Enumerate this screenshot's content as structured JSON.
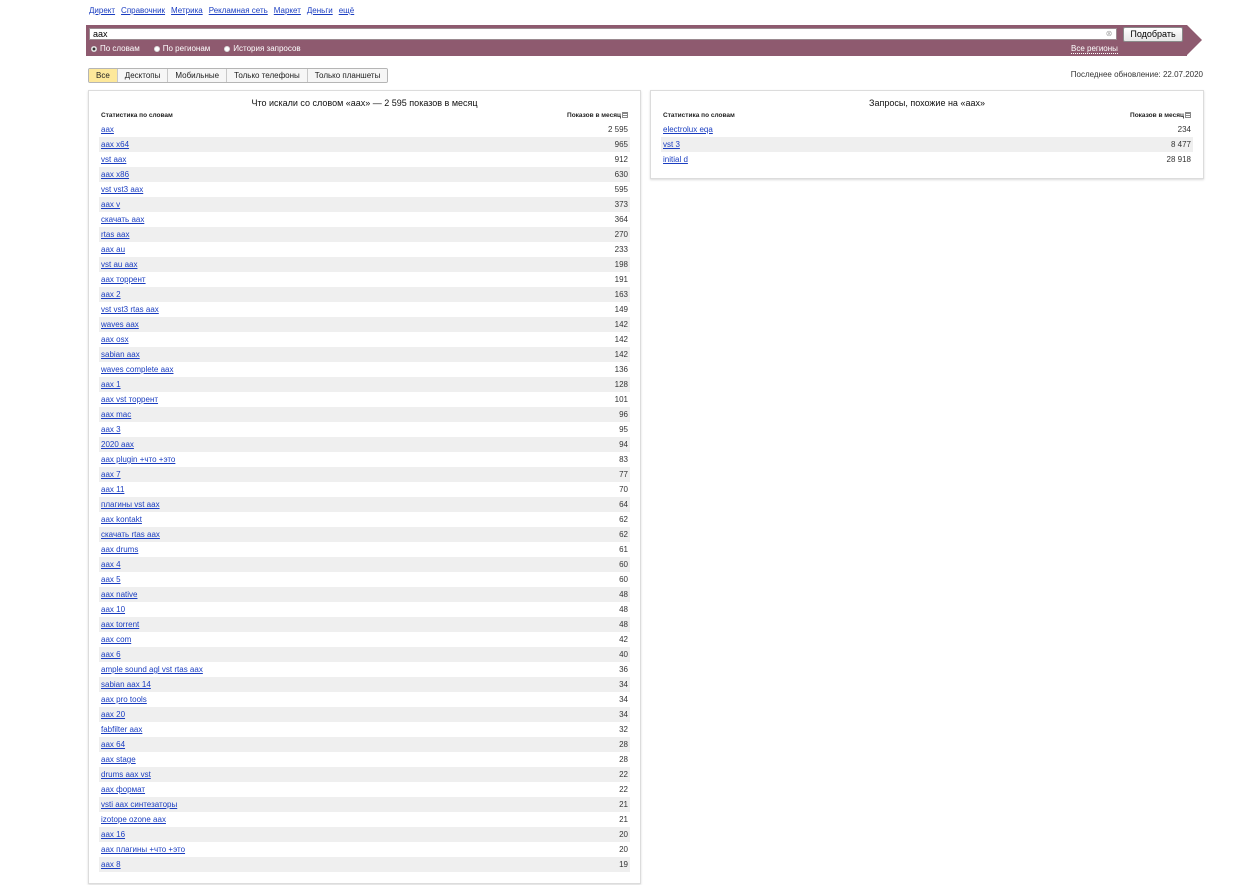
{
  "nav": [
    "Директ",
    "Справочник",
    "Метрика",
    "Рекламная сеть",
    "Маркет",
    "Деньги",
    "ещё"
  ],
  "search": {
    "value": "аах",
    "button_label": "Подобрать",
    "modes": [
      {
        "label": "По словам",
        "checked": true
      },
      {
        "label": "По регионам",
        "checked": false
      },
      {
        "label": "История запросов",
        "checked": false
      }
    ],
    "all_regions_label": "Все регионы"
  },
  "colors": {
    "band": "#8e5a6f",
    "active_tab": "#fde89a",
    "link": "#1a3dc1"
  },
  "tabs": [
    {
      "label": "Все",
      "active": true
    },
    {
      "label": "Десктопы",
      "active": false
    },
    {
      "label": "Мобильные",
      "active": false
    },
    {
      "label": "Только телефоны",
      "active": false
    },
    {
      "label": "Только планшеты",
      "active": false
    }
  ],
  "last_update": "Последнее обновление: 22.07.2020",
  "left_panel": {
    "title": "Что искали со словом «аах» — 2 595 показов в месяц",
    "col_phrase": "Статистика по словам",
    "col_shows": "Показов в месяц",
    "rows": [
      {
        "phrase": "aax",
        "shows": "2 595"
      },
      {
        "phrase": "aax x64",
        "shows": "965"
      },
      {
        "phrase": "vst aax",
        "shows": "912"
      },
      {
        "phrase": "aax x86",
        "shows": "630"
      },
      {
        "phrase": "vst vst3 aax",
        "shows": "595"
      },
      {
        "phrase": "aax v",
        "shows": "373"
      },
      {
        "phrase": "скачать aax",
        "shows": "364"
      },
      {
        "phrase": "rtas aax",
        "shows": "270"
      },
      {
        "phrase": "aax au",
        "shows": "233"
      },
      {
        "phrase": "vst au aax",
        "shows": "198"
      },
      {
        "phrase": "aax торрент",
        "shows": "191"
      },
      {
        "phrase": "aax 2",
        "shows": "163"
      },
      {
        "phrase": "vst vst3 rtas aax",
        "shows": "149"
      },
      {
        "phrase": "waves aax",
        "shows": "142"
      },
      {
        "phrase": "aax osx",
        "shows": "142"
      },
      {
        "phrase": "sabian aax",
        "shows": "142"
      },
      {
        "phrase": "waves complete aax",
        "shows": "136"
      },
      {
        "phrase": "aax 1",
        "shows": "128"
      },
      {
        "phrase": "aax vst торрент",
        "shows": "101"
      },
      {
        "phrase": "aax mac",
        "shows": "96"
      },
      {
        "phrase": "aax 3",
        "shows": "95"
      },
      {
        "phrase": "2020 aax",
        "shows": "94"
      },
      {
        "phrase": "aax plugin +что +это",
        "shows": "83"
      },
      {
        "phrase": "aax 7",
        "shows": "77"
      },
      {
        "phrase": "aax 11",
        "shows": "70"
      },
      {
        "phrase": "плагины vst aax",
        "shows": "64"
      },
      {
        "phrase": "aax kontakt",
        "shows": "62"
      },
      {
        "phrase": "скачать rtas aax",
        "shows": "62"
      },
      {
        "phrase": "aax drums",
        "shows": "61"
      },
      {
        "phrase": "aax 4",
        "shows": "60"
      },
      {
        "phrase": "aax 5",
        "shows": "60"
      },
      {
        "phrase": "aax native",
        "shows": "48"
      },
      {
        "phrase": "aax 10",
        "shows": "48"
      },
      {
        "phrase": "aax torrent",
        "shows": "48"
      },
      {
        "phrase": "aax com",
        "shows": "42"
      },
      {
        "phrase": "aax 6",
        "shows": "40"
      },
      {
        "phrase": "ample sound agl vst rtas aax",
        "shows": "36"
      },
      {
        "phrase": "sabian aax 14",
        "shows": "34"
      },
      {
        "phrase": "aax pro tools",
        "shows": "34"
      },
      {
        "phrase": "aax 20",
        "shows": "34"
      },
      {
        "phrase": "fabfilter aax",
        "shows": "32"
      },
      {
        "phrase": "aax 64",
        "shows": "28"
      },
      {
        "phrase": "aax stage",
        "shows": "28"
      },
      {
        "phrase": "drums aax vst",
        "shows": "22"
      },
      {
        "phrase": "aax формат",
        "shows": "22"
      },
      {
        "phrase": "vsti aax синтезаторы",
        "shows": "21"
      },
      {
        "phrase": "izotope ozone aax",
        "shows": "21"
      },
      {
        "phrase": "aax 16",
        "shows": "20"
      },
      {
        "phrase": "aax плагины +что +это",
        "shows": "20"
      },
      {
        "phrase": "aax 8",
        "shows": "19"
      }
    ]
  },
  "right_panel": {
    "title": "Запросы, похожие на «аах»",
    "col_phrase": "Статистика по словам",
    "col_shows": "Показов в месяц",
    "rows": [
      {
        "phrase": "electrolux eqa",
        "shows": "234"
      },
      {
        "phrase": "vst 3",
        "shows": "8 477"
      },
      {
        "phrase": "initial d",
        "shows": "28 918"
      }
    ]
  }
}
